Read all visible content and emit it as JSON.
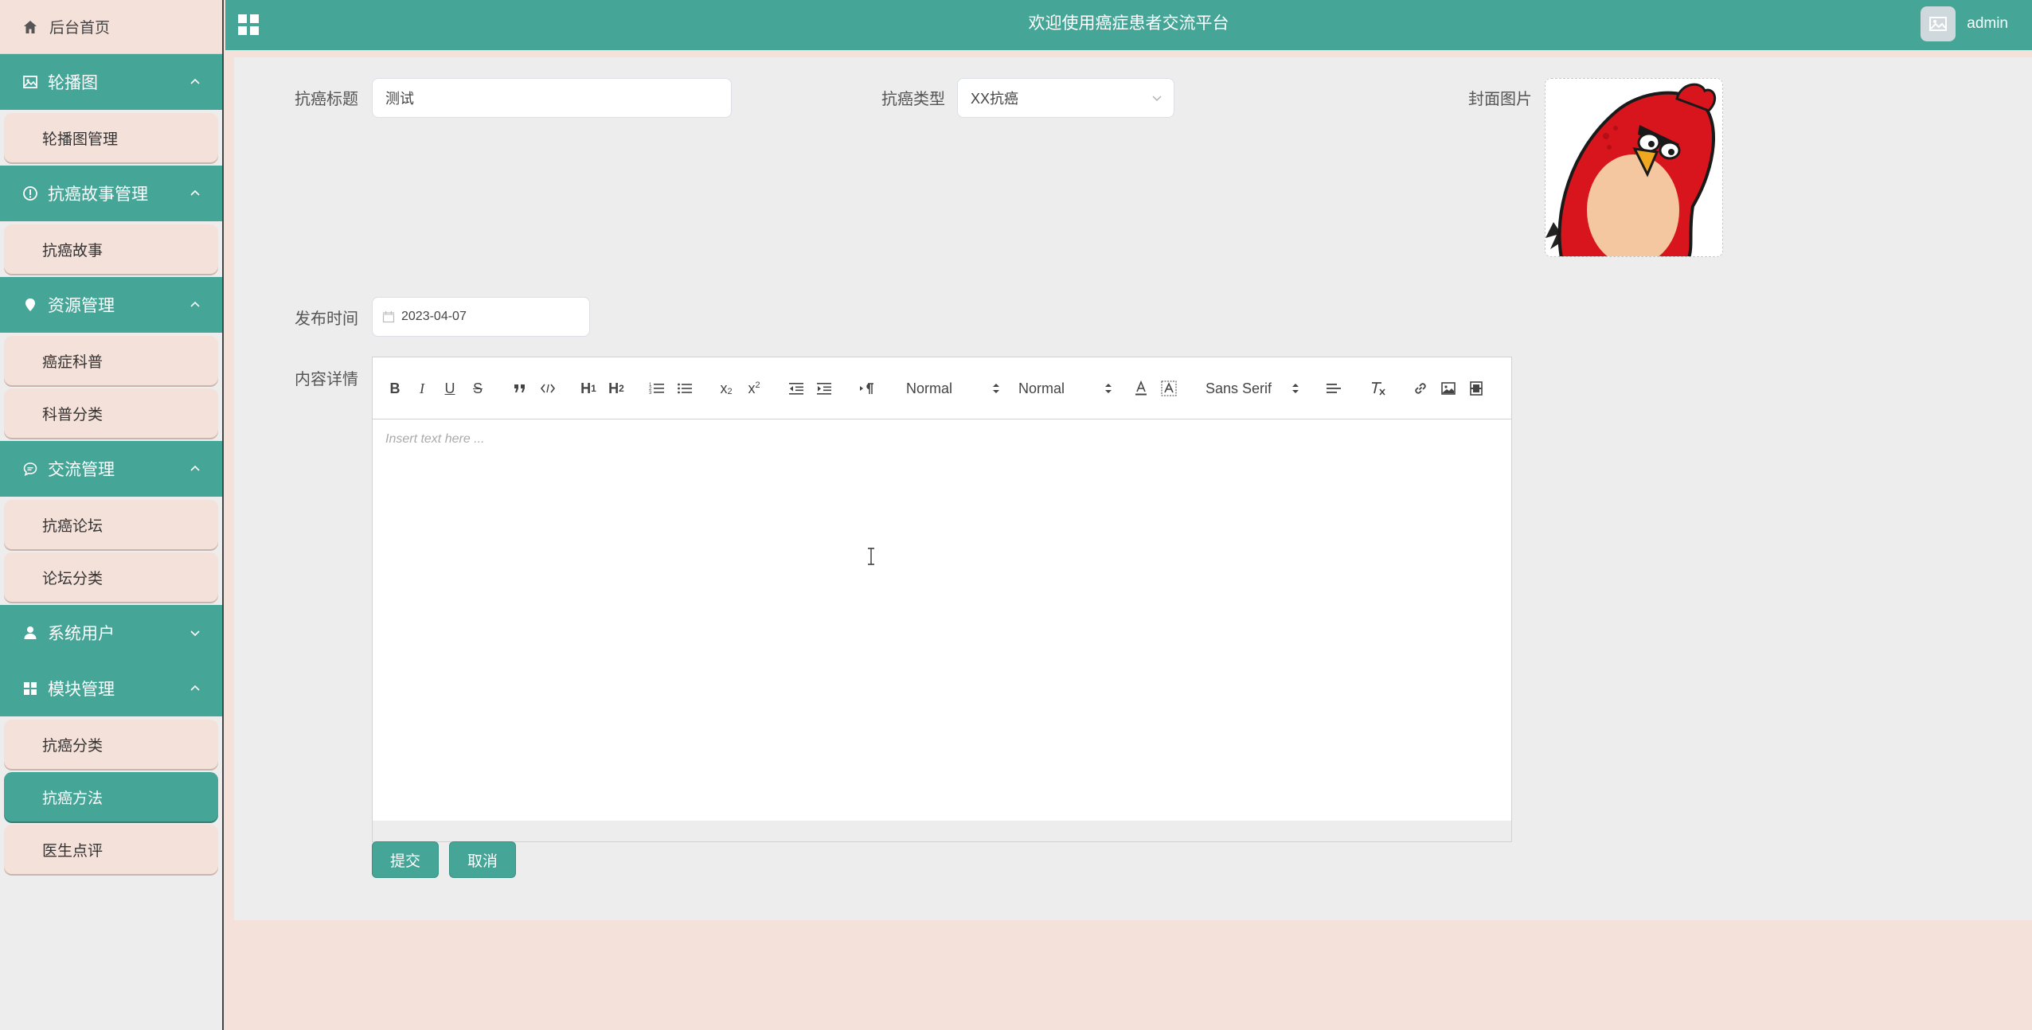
{
  "sidebar": {
    "home_label": "后台首页",
    "groups": [
      {
        "label": "轮播图",
        "icon": "image-icon",
        "expanded": true,
        "items": [
          {
            "label": "轮播图管理"
          }
        ]
      },
      {
        "label": "抗癌故事管理",
        "icon": "info-icon",
        "expanded": true,
        "items": [
          {
            "label": "抗癌故事"
          }
        ]
      },
      {
        "label": "资源管理",
        "icon": "location-pin-icon",
        "expanded": true,
        "items": [
          {
            "label": "癌症科普"
          },
          {
            "label": "科普分类"
          }
        ]
      },
      {
        "label": "交流管理",
        "icon": "chat-bubble-icon",
        "expanded": true,
        "items": [
          {
            "label": "抗癌论坛"
          },
          {
            "label": "论坛分类"
          }
        ]
      },
      {
        "label": "系统用户",
        "icon": "user-icon",
        "expanded": false,
        "items": []
      },
      {
        "label": "模块管理",
        "icon": "grid-icon",
        "expanded": true,
        "items": [
          {
            "label": "抗癌分类"
          },
          {
            "label": "抗癌方法",
            "active": true
          },
          {
            "label": "医生点评"
          }
        ]
      }
    ]
  },
  "header": {
    "title": "欢迎使用癌症患者交流平台",
    "username": "admin"
  },
  "form": {
    "title_label": "抗癌标题",
    "title_value": "测试",
    "type_label": "抗癌类型",
    "type_value": "XX抗癌",
    "cover_label": "封面图片",
    "date_label": "发布时间",
    "date_value": "2023-04-07",
    "content_label": "内容详情",
    "editor": {
      "placeholder": "Insert text here ...",
      "header_select": "Normal",
      "size_select": "Normal",
      "font_select": "Sans Serif"
    },
    "submit_label": "提交",
    "cancel_label": "取消"
  },
  "colors": {
    "primary": "#45a597",
    "sidebar_item_bg": "#f4e1da",
    "panel_bg": "#ededed"
  }
}
